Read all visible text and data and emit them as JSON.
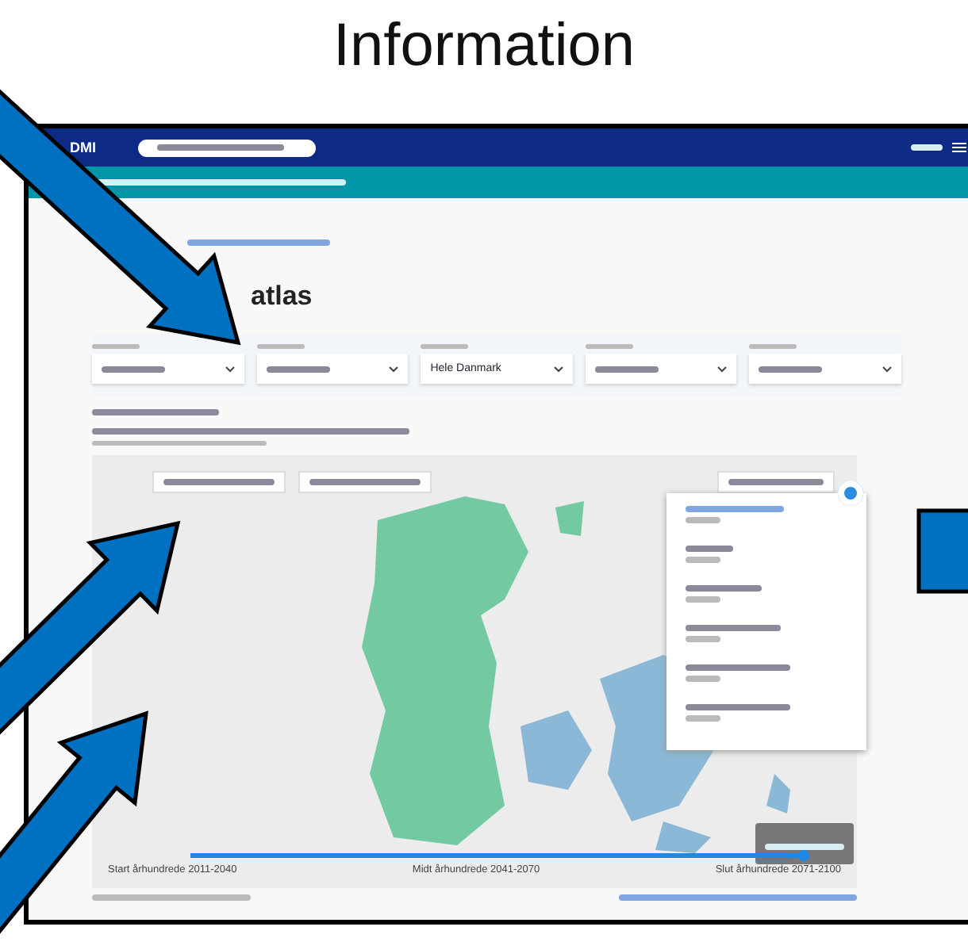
{
  "title": "Information",
  "screenshot": {
    "logo": "DMI",
    "page_title": "atlas",
    "filters": [
      {
        "kind": "blurred"
      },
      {
        "kind": "blurred"
      },
      {
        "kind": "text",
        "value": "Hele Danmark"
      },
      {
        "kind": "blurred"
      },
      {
        "kind": "blurred"
      }
    ],
    "slider": {
      "level": 1,
      "labels": [
        "Start århundrede 2011-2040",
        "Midt århundrede 2041-2070",
        "Slut århundrede 2071-2100"
      ]
    }
  }
}
